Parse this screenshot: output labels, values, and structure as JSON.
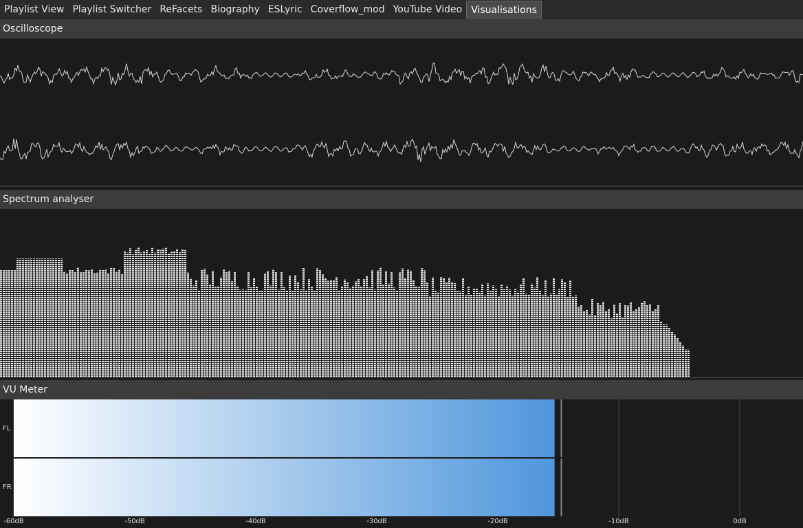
{
  "tabs": [
    {
      "label": "Playlist View",
      "active": false
    },
    {
      "label": "Playlist Switcher",
      "active": false
    },
    {
      "label": "ReFacets",
      "active": false
    },
    {
      "label": "Biography",
      "active": false
    },
    {
      "label": "ESLyric",
      "active": false
    },
    {
      "label": "Coverflow_mod",
      "active": false
    },
    {
      "label": "YouTube Video",
      "active": false
    },
    {
      "label": "Visualisations",
      "active": true
    }
  ],
  "oscilloscope": {
    "title": "Oscilloscope",
    "channels": 2
  },
  "spectrum": {
    "title": "Spectrum analyser"
  },
  "vu": {
    "title": "VU Meter",
    "channels": [
      {
        "label": "FL",
        "level_db": -15.3,
        "peak_db": -14.8
      },
      {
        "label": "FR",
        "level_db": -15.3,
        "peak_db": -14.8
      }
    ],
    "scale": [
      "-60dB",
      "-50dB",
      "-40dB",
      "-30dB",
      "-20dB",
      "-10dB",
      "0dB"
    ],
    "colors": {
      "low": "#ffffff",
      "high": "#4f96dc"
    }
  },
  "colors": {
    "background": "#1b1b1b",
    "wave": "#d8d8d8",
    "bars": "#e6e6e6"
  }
}
